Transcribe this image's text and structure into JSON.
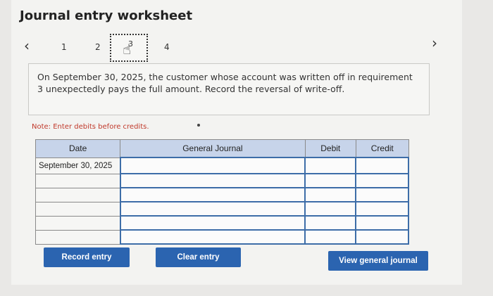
{
  "header": {
    "title": "Journal entry worksheet"
  },
  "nav": {
    "prev_icon": "chevron-left-icon",
    "next_icon": "chevron-right-icon",
    "steps": [
      "1",
      "2",
      "3",
      "4"
    ],
    "active_step": "3"
  },
  "question": {
    "text": "On September 30, 2025, the customer whose account was written off in requirement 3 unexpectedly pays the full amount. Record the reversal of write-off."
  },
  "note": "Note: Enter debits before credits.",
  "table": {
    "headers": [
      "Date",
      "General Journal",
      "Debit",
      "Credit"
    ],
    "rows": [
      [
        "September 30, 2025",
        "",
        "",
        ""
      ],
      [
        "",
        "",
        "",
        ""
      ],
      [
        "",
        "",
        "",
        ""
      ],
      [
        "",
        "",
        "",
        ""
      ],
      [
        "",
        "",
        "",
        ""
      ],
      [
        "",
        "",
        "",
        ""
      ]
    ]
  },
  "buttons": {
    "record": "Record entry",
    "clear": "Clear entry",
    "view": "View general journal"
  },
  "colors": {
    "accent": "#2b64b0",
    "header_bg": "#c7d4ea",
    "note": "#c0392b"
  }
}
